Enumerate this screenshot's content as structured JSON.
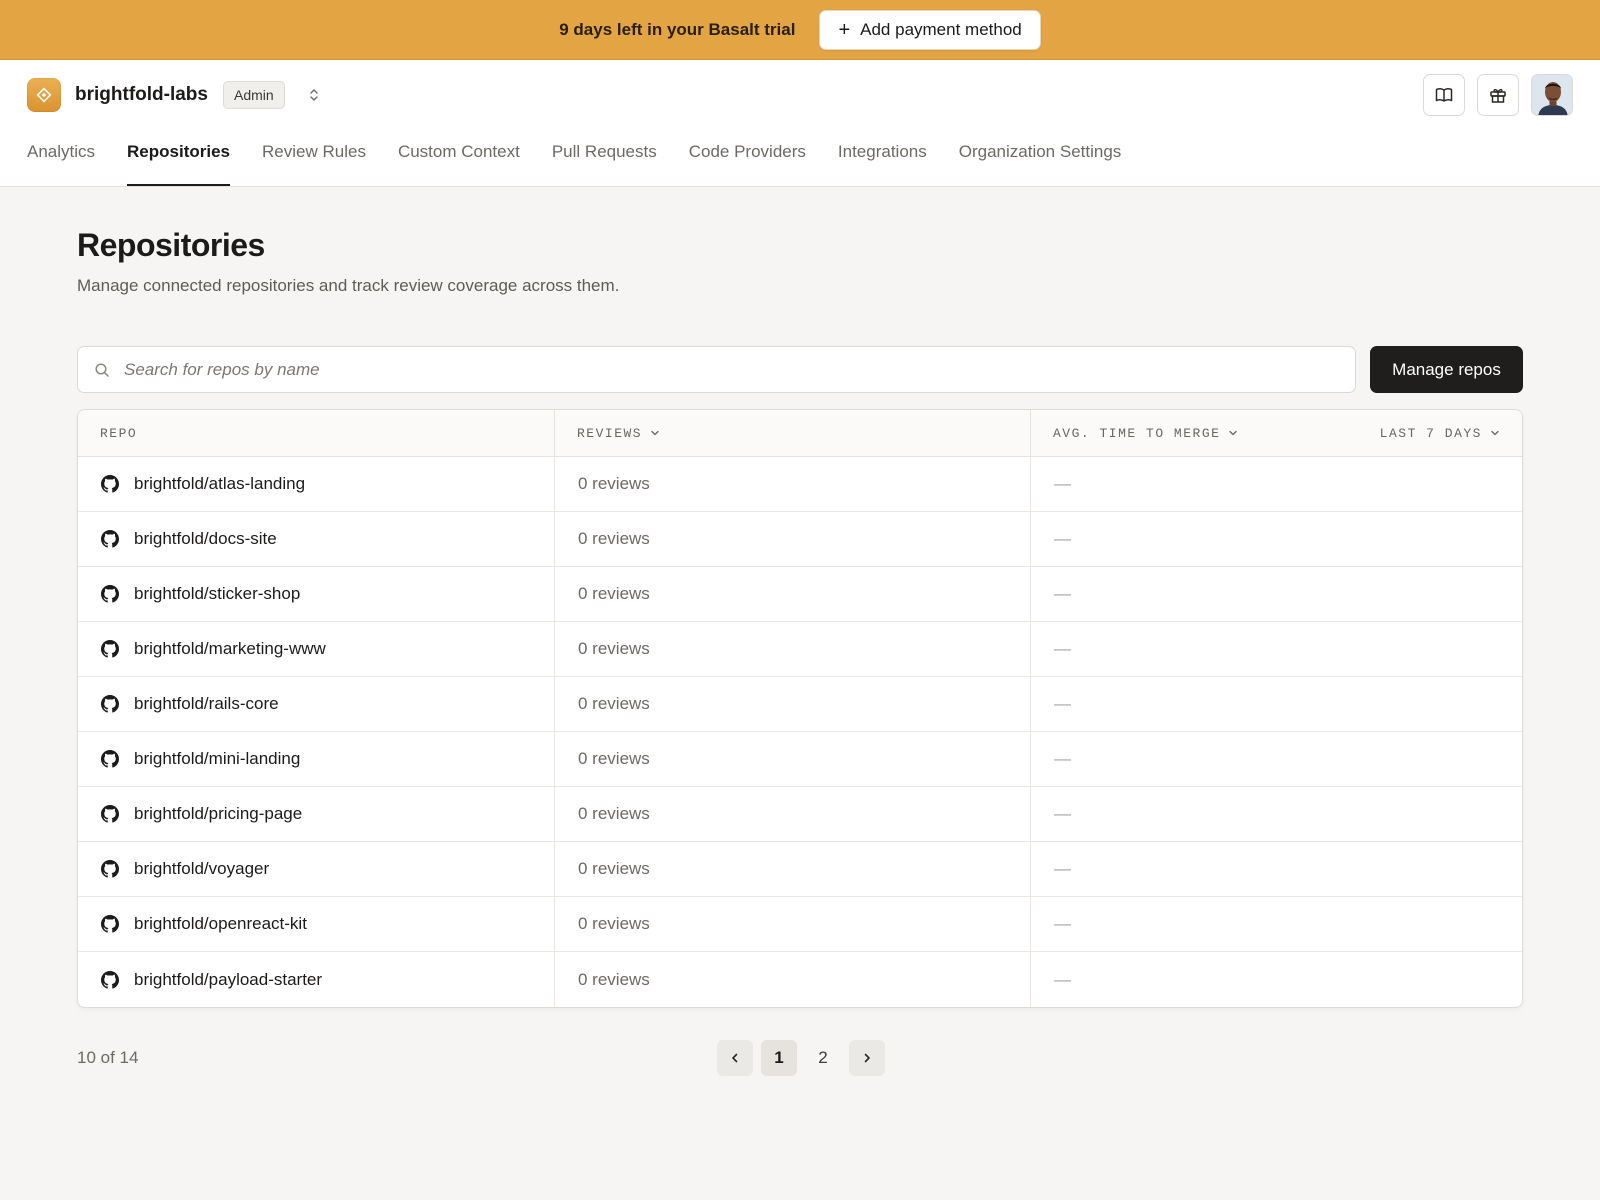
{
  "banner": {
    "text": "9 days left in your Basalt trial",
    "button_label": "Add payment method"
  },
  "org": {
    "name": "brightfold-labs",
    "role": "Admin"
  },
  "nav": {
    "tabs": [
      {
        "label": "Analytics",
        "active": false
      },
      {
        "label": "Repositories",
        "active": true
      },
      {
        "label": "Review Rules",
        "active": false
      },
      {
        "label": "Custom Context",
        "active": false
      },
      {
        "label": "Pull Requests",
        "active": false
      },
      {
        "label": "Code Providers",
        "active": false
      },
      {
        "label": "Integrations",
        "active": false
      },
      {
        "label": "Organization Settings",
        "active": false
      }
    ]
  },
  "page": {
    "title": "Repositories",
    "subtitle": "Manage connected repositories and track review coverage across them."
  },
  "search": {
    "placeholder": "Search for repos by name",
    "value": ""
  },
  "toolbar": {
    "manage_label": "Manage repos"
  },
  "table": {
    "columns": {
      "repo": "REPO",
      "reviews": "REVIEWS",
      "avg_time": "AVG. TIME TO MERGE",
      "range": "LAST 7 DAYS"
    },
    "rows": [
      {
        "repo": "brightfold/atlas-landing",
        "reviews": "0 reviews",
        "avg_time": "—"
      },
      {
        "repo": "brightfold/docs-site",
        "reviews": "0 reviews",
        "avg_time": "—"
      },
      {
        "repo": "brightfold/sticker-shop",
        "reviews": "0 reviews",
        "avg_time": "—"
      },
      {
        "repo": "brightfold/marketing-www",
        "reviews": "0 reviews",
        "avg_time": "—"
      },
      {
        "repo": "brightfold/rails-core",
        "reviews": "0 reviews",
        "avg_time": "—"
      },
      {
        "repo": "brightfold/mini-landing",
        "reviews": "0 reviews",
        "avg_time": "—"
      },
      {
        "repo": "brightfold/pricing-page",
        "reviews": "0 reviews",
        "avg_time": "—"
      },
      {
        "repo": "brightfold/voyager",
        "reviews": "0 reviews",
        "avg_time": "—"
      },
      {
        "repo": "brightfold/openreact-kit",
        "reviews": "0 reviews",
        "avg_time": "—"
      },
      {
        "repo": "brightfold/payload-starter",
        "reviews": "0 reviews",
        "avg_time": "—"
      }
    ]
  },
  "pagination": {
    "summary": "10 of 14",
    "pages": [
      "1",
      "2"
    ],
    "current": "1"
  },
  "icons": {
    "row_icon": "github-icon",
    "banner_button_icon": "plus-icon",
    "search_icon": "search-icon",
    "docs": "book-icon",
    "gifts": "gift-icon"
  },
  "colors": {
    "banner": "#e3a544",
    "brand_logo": "#e0a040",
    "primary_button": "#1f1e1d",
    "background": "#f6f5f3"
  }
}
